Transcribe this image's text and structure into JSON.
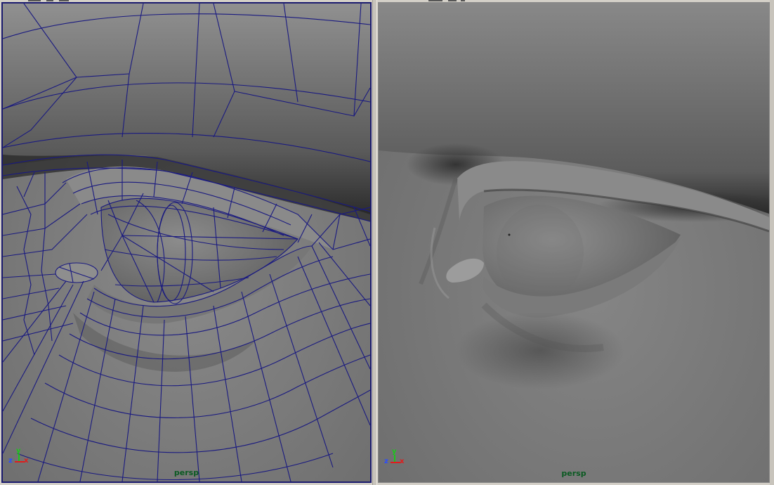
{
  "viewports": [
    {
      "id": "left",
      "camera": "persp",
      "display_mode": "wireframe on shaded",
      "active": true,
      "axis": {
        "x": "x",
        "y": "y",
        "z": "z"
      }
    },
    {
      "id": "right",
      "camera": "persp",
      "display_mode": "smooth shaded",
      "active": false,
      "axis": {
        "x": "x",
        "y": "y",
        "z": "z"
      }
    }
  ],
  "colors": {
    "wire": "#1a1a80",
    "active_border": "#1a1a6e",
    "camera_label": "#0b5a22",
    "axis_x": "#e01c1c",
    "axis_y": "#19c819",
    "axis_z": "#2a4cff"
  }
}
